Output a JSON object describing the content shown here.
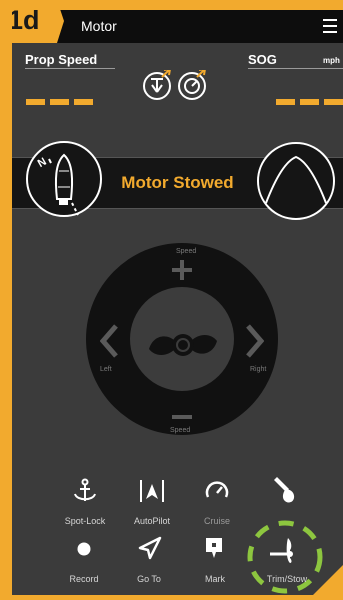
{
  "header": {
    "step": "1d",
    "title": "Motor",
    "menu_icon": "hamburger-menu-icon"
  },
  "readouts": {
    "left": {
      "label": "Prop Speed",
      "value": "- - -"
    },
    "right": {
      "label": "SOG",
      "unit": "mph",
      "value": "- - -"
    }
  },
  "status": {
    "text": "Motor Stowed"
  },
  "joystick": {
    "speed_top": "Speed",
    "speed_bottom": "Speed",
    "left": "Left",
    "right": "Right"
  },
  "actions_row1": [
    {
      "label": "Spot-Lock",
      "icon": "anchor-icon"
    },
    {
      "label": "AutoPilot",
      "icon": "autopilot-icon"
    },
    {
      "label": "Cruise",
      "icon": "speedometer-icon"
    },
    {
      "label": "",
      "icon": "wrench-icon"
    }
  ],
  "actions_row2": [
    {
      "label": "Record",
      "icon": "record-dot-icon"
    },
    {
      "label": "Go To",
      "icon": "navigate-arrow-icon"
    },
    {
      "label": "Mark",
      "icon": "waypoint-mark-icon"
    },
    {
      "label": "Trim/Stow",
      "icon": "trim-stow-icon"
    }
  ],
  "colors": {
    "accent": "#f2aa2e",
    "highlight": "#8dc63f",
    "panel": "#3b3b3b"
  }
}
